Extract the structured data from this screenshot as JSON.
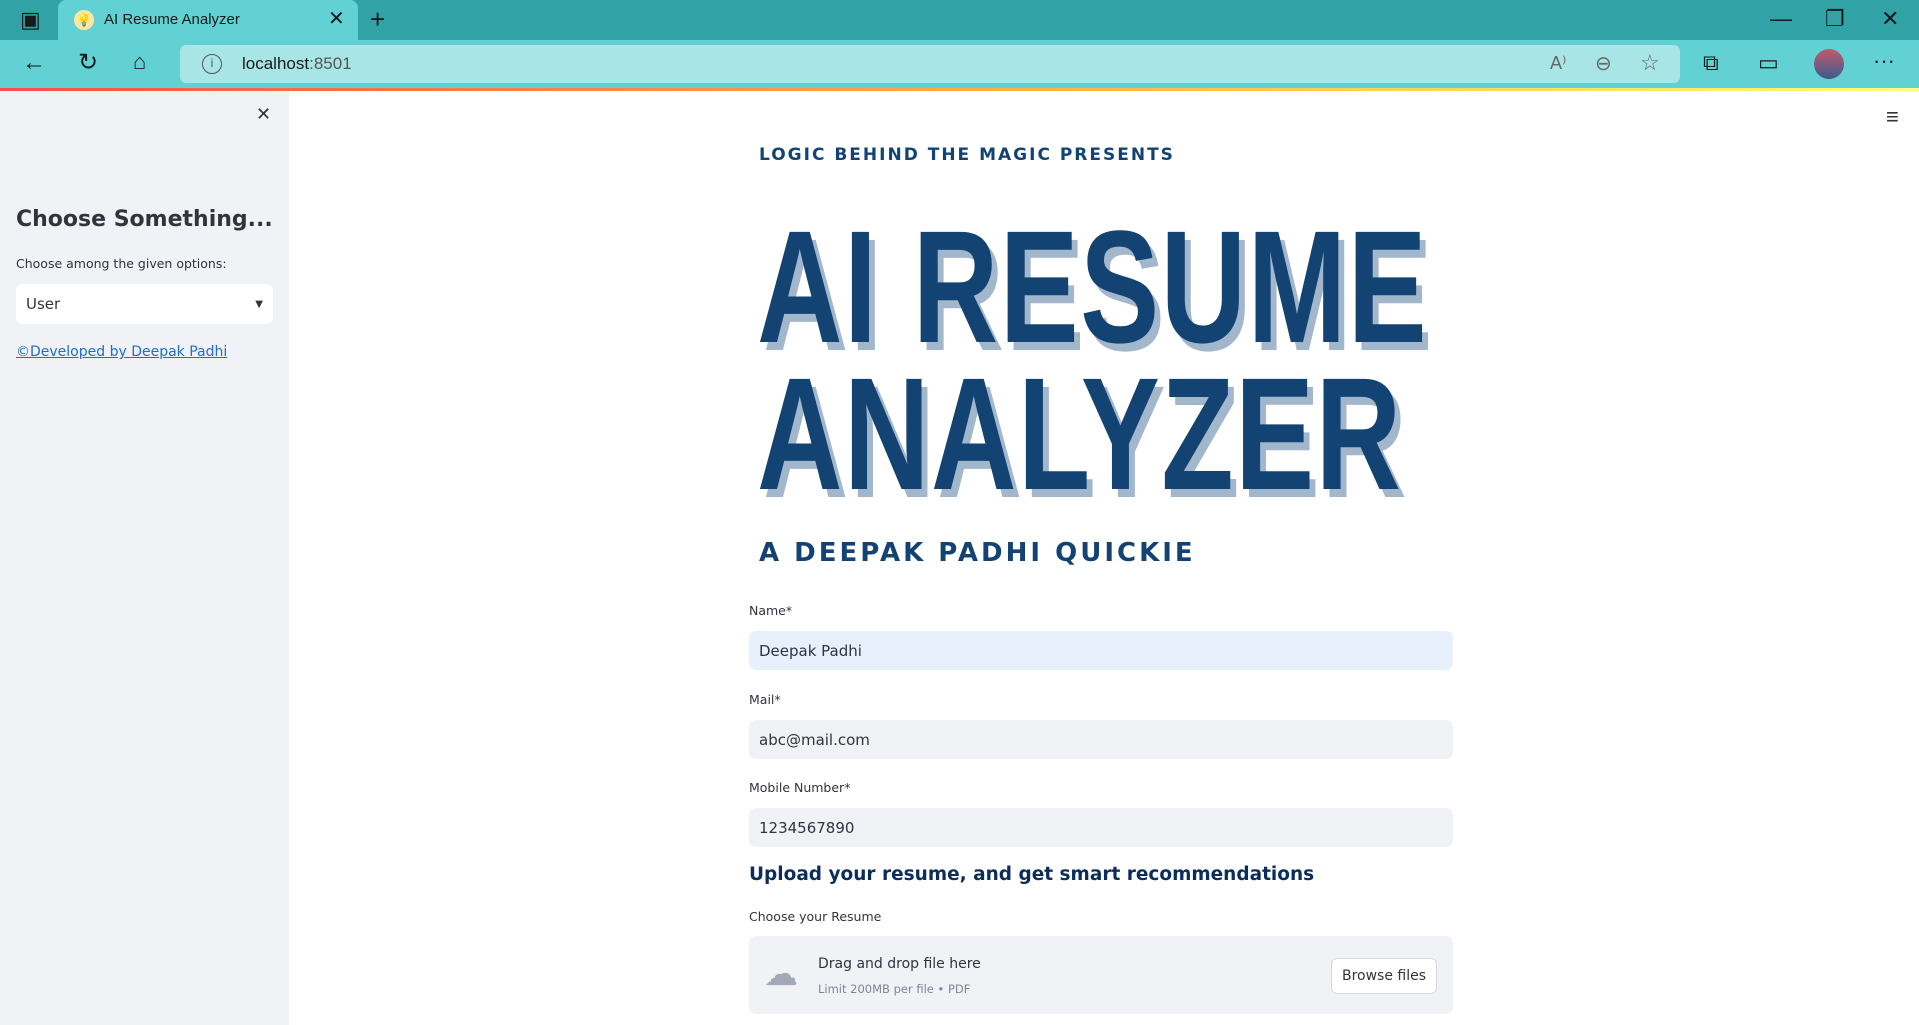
{
  "browser": {
    "tab_title": "AI Resume Analyzer",
    "url_host": "localhost",
    "url_port": ":8501"
  },
  "sidebar": {
    "title": "Choose Something...",
    "select_label": "Choose among the given options:",
    "select_value": "User",
    "link": "©Developed by Deepak Padhi"
  },
  "main": {
    "presents": "LOGIC BEHIND THE MAGIC PRESENTS",
    "title_line1": "AI RESUME",
    "title_line2": "ANALYZER",
    "subtitle": "A DEEPAK PADHI QUICKIE",
    "fields": [
      {
        "label": "Name*",
        "value": "Deepak Padhi"
      },
      {
        "label": "Mail*",
        "value": "abc@mail.com"
      },
      {
        "label": "Mobile Number*",
        "value": "1234567890"
      }
    ],
    "upload_heading": "Upload your resume, and get smart recommendations",
    "upload_label": "Choose your Resume",
    "dropzone_text": "Drag and drop file here",
    "dropzone_limit": "Limit 200MB per file • PDF",
    "browse_label": "Browse files"
  },
  "colors": {
    "accent": "#134373",
    "shadow": "#a2b6cc",
    "browser": "#31a3a7"
  }
}
